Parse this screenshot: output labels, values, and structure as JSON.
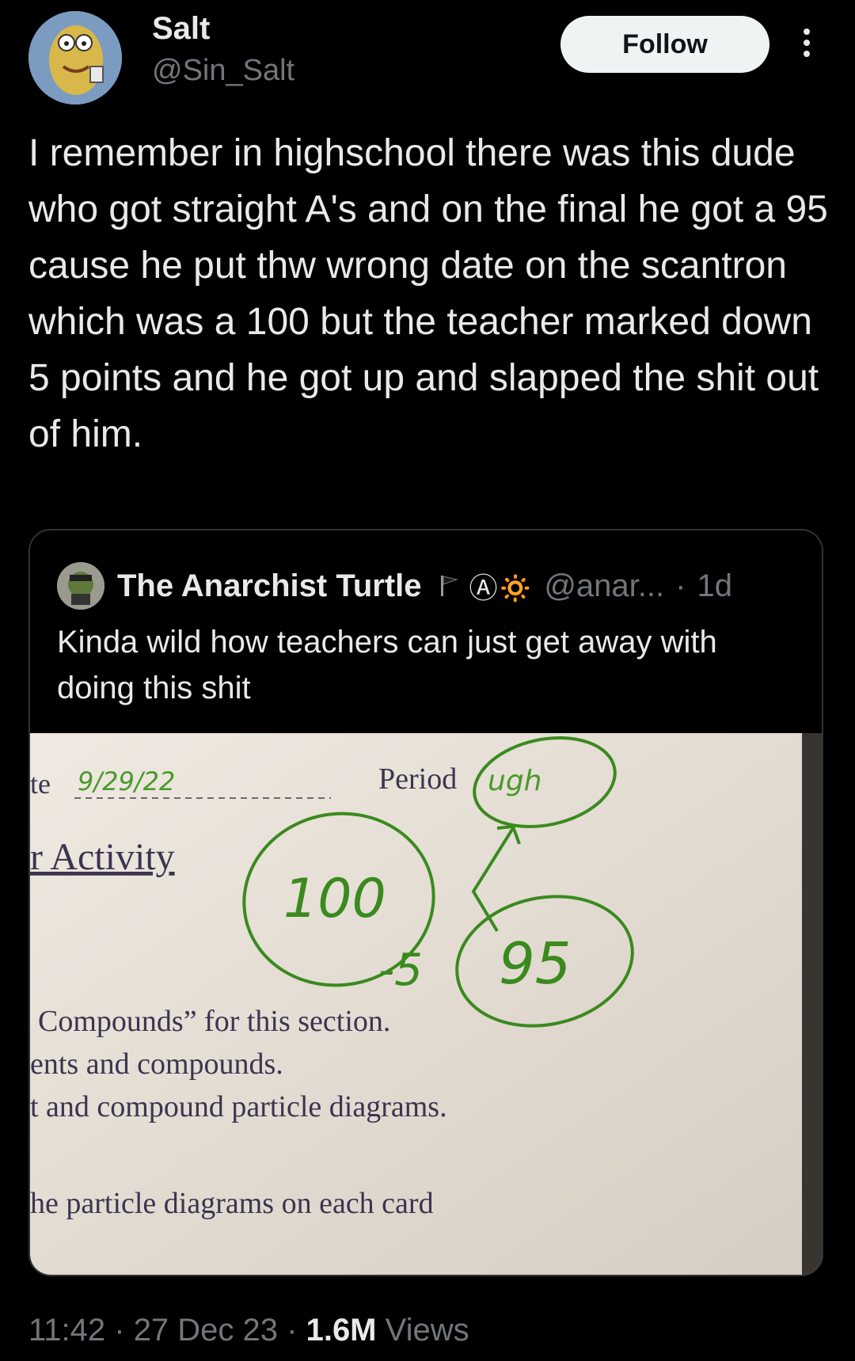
{
  "author": {
    "name": "Salt",
    "handle": "@Sin_Salt",
    "avatar_icon": "avatar-icon"
  },
  "follow_label": "Follow",
  "more_icon": "more-options-icon",
  "tweet_text": "I remember in highschool there was this dude who got straight A's and on the final he got a 95 cause he put thw wrong date on the scantron which was a 100 but the teacher marked down 5 points and he got up and slapped the shit out of him.",
  "quote": {
    "name": "The Anarchist Turtle",
    "flag_icon": "flag-icon",
    "emoji": "Ⓐ🔅",
    "handle": "@anar...",
    "sep": "·",
    "time": "1d",
    "text": "Kinda wild how teachers can just get away with doing this shit",
    "image": {
      "date_label": "te",
      "date_value": "9/29/22",
      "period_label": "Period",
      "period_value": "ugh",
      "heading": "r Activity",
      "score_original": "100",
      "deduction": "-5",
      "score_final": "95",
      "line1": "Compounds” for this section.",
      "line2": "ents and compounds.",
      "line3": "t and compound particle diagrams.",
      "line4": "he particle diagrams on each card"
    }
  },
  "meta": {
    "time": "11:42",
    "sep1": " · ",
    "date": "27 Dec 23",
    "sep2": " · ",
    "views_count": "1.6M",
    "views_label": " Views"
  },
  "colors": {
    "background": "#000000",
    "text": "#e7e9ea",
    "secondary": "#71767b",
    "border": "#2f3336",
    "ink_green": "#3a8a1e",
    "paper": "#ece6de"
  }
}
